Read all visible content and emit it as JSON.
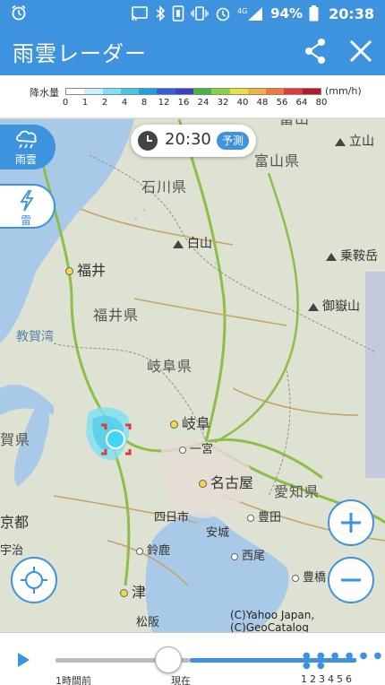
{
  "status_bar": {
    "battery": "94%",
    "time": "20:38"
  },
  "app_bar": {
    "title": "雨雲レーダー"
  },
  "legend": {
    "label": "降水量",
    "unit": "(mm/h)",
    "ticks": [
      "0",
      "1",
      "2",
      "4",
      "8",
      "12",
      "16",
      "24",
      "32",
      "40",
      "48",
      "56",
      "64",
      "80"
    ],
    "colors": [
      "#ffffff",
      "#c9f1fb",
      "#7de1f4",
      "#3fc6ea",
      "#1e9fe6",
      "#2b62d6",
      "#3d3fc6",
      "#3fb54a",
      "#87d43c",
      "#e8e23a",
      "#f2b43a",
      "#ee7a36",
      "#e23a3a",
      "#b8172a"
    ]
  },
  "time_badge": {
    "time": "20:30",
    "mode": "予測"
  },
  "side_buttons": {
    "rain": "雨雲",
    "thunder": "雷"
  },
  "map": {
    "prefectures": [
      "石川県",
      "富山県",
      "福井県",
      "岐阜県",
      "愛知県"
    ],
    "bays": [
      "教賀湾"
    ],
    "partial_labels": [
      "富山",
      "賀県",
      "京都",
      "宇治"
    ],
    "cities": [
      {
        "name": "福井",
        "type": "major"
      },
      {
        "name": "岐阜",
        "type": "major"
      },
      {
        "name": "名古屋",
        "type": "major"
      },
      {
        "name": "津",
        "type": "major"
      },
      {
        "name": "一宮",
        "type": "minor"
      },
      {
        "name": "四日市",
        "type": "minor"
      },
      {
        "name": "豊田",
        "type": "minor"
      },
      {
        "name": "安城",
        "type": "minor"
      },
      {
        "name": "鈴鹿",
        "type": "minor"
      },
      {
        "name": "西尾",
        "type": "minor"
      },
      {
        "name": "豊橋",
        "type": "minor"
      },
      {
        "name": "松阪",
        "type": "minor"
      }
    ],
    "mountains": [
      "立山",
      "白山",
      "乗鞍岳",
      "御嶽山"
    ],
    "copyright": "(C)Yahoo Japan,(C)GeoCatalog"
  },
  "timeline": {
    "start_label": "1時間前",
    "now_label": "現在",
    "future_ticks": "123456",
    "position": 0.375
  }
}
